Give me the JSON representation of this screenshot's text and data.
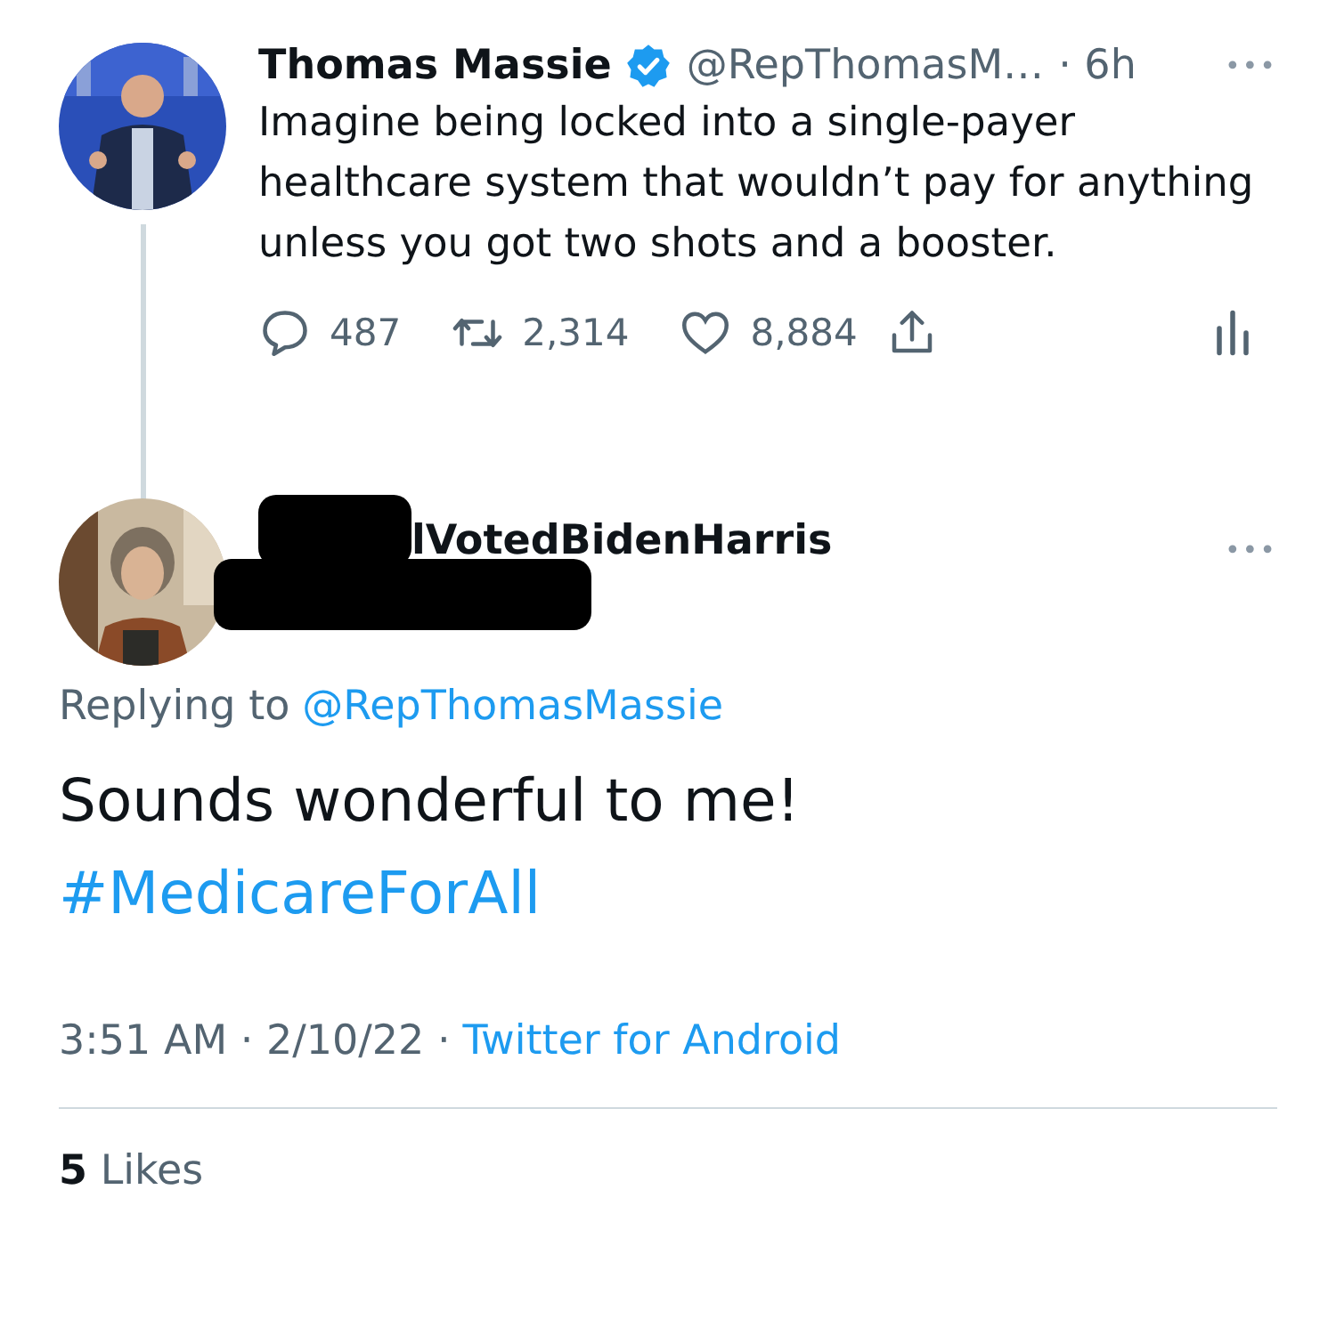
{
  "parent_tweet": {
    "name": "Thomas Massie",
    "verified": true,
    "handle": "@RepThomasM…",
    "time": "· 6h",
    "more": "•••",
    "text": "Imagine being locked into a single-payer healthcare system that wouldn’t pay for anything unless you got two shots and a booster.",
    "actions": [
      {
        "kind": "reply",
        "count": "487"
      },
      {
        "kind": "retweet",
        "count": "2,314"
      },
      {
        "kind": "like",
        "count": "8,884"
      },
      {
        "kind": "share"
      },
      {
        "kind": "analytics"
      }
    ]
  },
  "reply_tweet": {
    "name_visible": "lVotedBidenHarris",
    "more": "•••",
    "replying_label": "Replying to",
    "replying_to": "@RepThomasMassie",
    "text": "Sounds wonderful to me!",
    "hashtag": "#MedicareForAll",
    "timestamp": "3:51 AM · 2/10/22 ·",
    "source": "Twitter for Android",
    "likes_count": "5",
    "likes_label": "Likes"
  }
}
